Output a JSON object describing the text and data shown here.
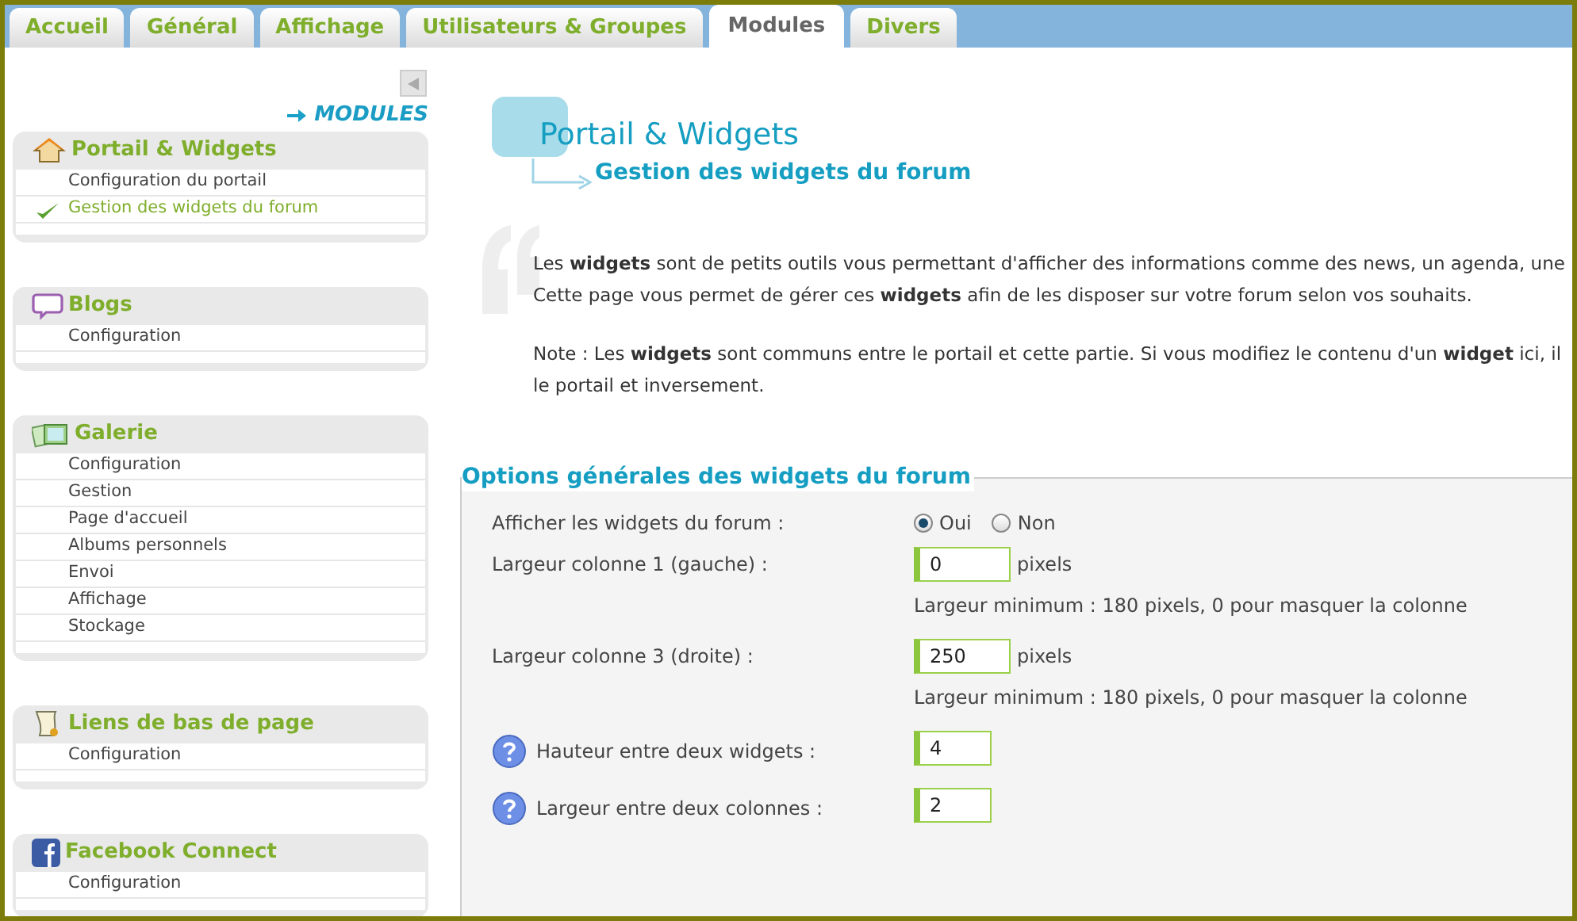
{
  "tabs": [
    {
      "label": "Accueil",
      "selected": false
    },
    {
      "label": "Général",
      "selected": false
    },
    {
      "label": "Affichage",
      "selected": false
    },
    {
      "label": "Utilisateurs & Groupes",
      "selected": false
    },
    {
      "label": "Modules",
      "selected": true
    },
    {
      "label": "Divers",
      "selected": false
    }
  ],
  "sidebar": {
    "heading": "MODULES",
    "sections": [
      {
        "title": "Portail & Widgets",
        "items": [
          {
            "label": "Configuration du portail",
            "selected": false
          },
          {
            "label": "Gestion des widgets du forum",
            "selected": true
          }
        ]
      },
      {
        "title": "Blogs",
        "items": [
          {
            "label": "Configuration",
            "selected": false
          }
        ]
      },
      {
        "title": "Galerie",
        "items": [
          {
            "label": "Configuration",
            "selected": false
          },
          {
            "label": "Gestion",
            "selected": false
          },
          {
            "label": "Page d'accueil",
            "selected": false
          },
          {
            "label": "Albums personnels",
            "selected": false
          },
          {
            "label": "Envoi",
            "selected": false
          },
          {
            "label": "Affichage",
            "selected": false
          },
          {
            "label": "Stockage",
            "selected": false
          }
        ]
      },
      {
        "title": "Liens de bas de page",
        "items": [
          {
            "label": "Configuration",
            "selected": false
          }
        ]
      },
      {
        "title": "Facebook Connect",
        "items": [
          {
            "label": "Configuration",
            "selected": false
          }
        ]
      }
    ]
  },
  "page": {
    "title": "Portail & Widgets",
    "subtitle": "Gestion des widgets du forum",
    "paragraphs": [
      [
        "Les **widgets** sont de petits outils vous permettant d'afficher des informations comme des news, un agenda, une",
        "Cette page vous permet de gérer ces **widgets** afin de les disposer sur votre forum selon vos souhaits."
      ],
      [
        "Note : Les **widgets** sont communs entre le portail et cette partie. Si vous modifiez le contenu d'un **widget** ici, il",
        "le portail et inversement."
      ]
    ]
  },
  "form": {
    "legend": "Options générales des widgets du forum",
    "rows": [
      {
        "kind": "radio",
        "label": "Afficher les widgets du forum :",
        "options": [
          {
            "label": "Oui",
            "selected": true
          },
          {
            "label": "Non",
            "selected": false
          }
        ]
      },
      {
        "kind": "input",
        "label": "Largeur colonne 1 (gauche) :",
        "value": "0",
        "unit": "pixels",
        "hint": "Largeur minimum : 180 pixels, 0 pour masquer la colonne",
        "help": false
      },
      {
        "kind": "input",
        "label": "Largeur colonne 3 (droite) :",
        "value": "250",
        "unit": "pixels",
        "hint": "Largeur minimum : 180 pixels, 0 pour masquer la colonne",
        "help": false
      },
      {
        "kind": "input",
        "label": "Hauteur entre deux widgets :",
        "value": "4",
        "help": true
      },
      {
        "kind": "input",
        "label": "Largeur entre deux colonnes :",
        "value": "2",
        "help": true
      }
    ]
  }
}
